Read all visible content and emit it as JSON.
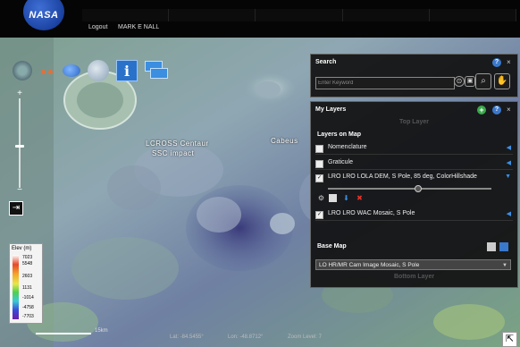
{
  "header": {
    "logo_text": "NASA",
    "logout_label": "Logout",
    "username": "MARK E NALL"
  },
  "map": {
    "labels": [
      "LCROSS Centaur",
      "SSC impact",
      "Cabeus"
    ]
  },
  "legend": {
    "title": "Elev (m)",
    "ticks": [
      "7023",
      "5548",
      "2603",
      "1131",
      "-1014",
      "-4758",
      "-7703"
    ]
  },
  "statusbar": {
    "scale": "15km",
    "lat": "Lat: -84.5455°",
    "lon": "Lon: -48.8712°",
    "zoom": "Zoom Level: 7"
  },
  "search_panel": {
    "title": "Search",
    "placeholder": "Enter Keyword"
  },
  "layers_panel": {
    "title": "My Layers",
    "top_layer": "Top Layer",
    "layers_on_map": "Layers on Map",
    "layers": [
      {
        "name": "Nomenclature",
        "checked": false
      },
      {
        "name": "Graticule",
        "checked": false
      },
      {
        "name": "LRO LRO LOLA DEM, S Pole, 85 deg, ColorHillshade",
        "checked": true
      },
      {
        "name": "LRO LRO WAC Mosaic, S Pole",
        "checked": true
      }
    ],
    "opacity": 0.55,
    "base_map_label": "Base Map",
    "base_map_value": "LO HR/MR Cam Image Mosaic, S Pole",
    "bottom_layer": "Bottom Layer"
  },
  "colors": {
    "accent": "#3a8fe5",
    "panel_bg": "#101010",
    "add_green": "#3aa84a"
  }
}
